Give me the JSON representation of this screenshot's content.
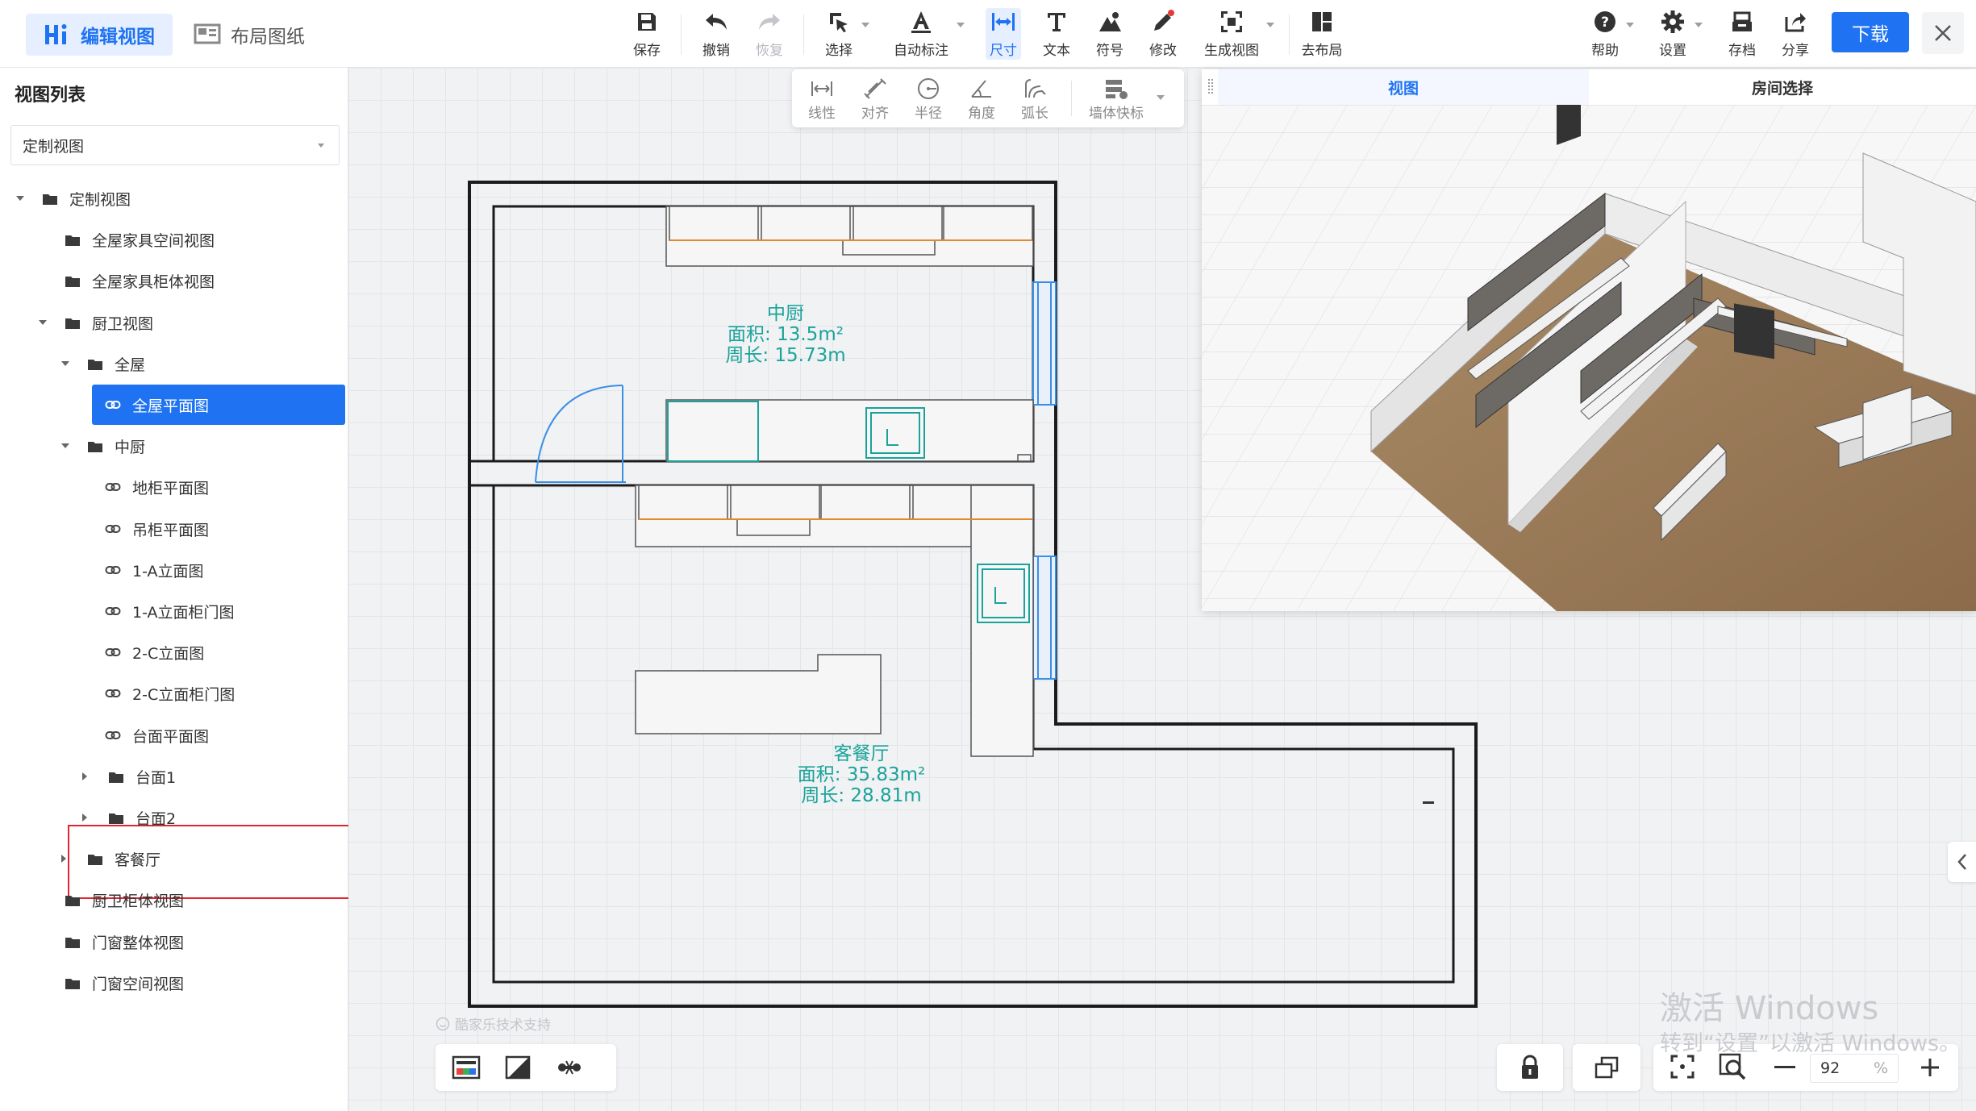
{
  "header": {
    "mode_tabs": [
      {
        "label": "编辑视图",
        "active": true
      },
      {
        "label": "布局图纸",
        "active": false
      }
    ],
    "tools": {
      "save": "保存",
      "undo": "撤销",
      "redo": "恢复",
      "select": "选择",
      "auto_dim": "自动标注",
      "dimension": "尺寸",
      "text": "文本",
      "symbol": "符号",
      "modify": "修改",
      "gen_view": "生成视图",
      "to_layout": "去布局"
    },
    "right_tools": {
      "help": "帮助",
      "settings": "设置",
      "archive": "存档",
      "share": "分享"
    },
    "download": "下载",
    "accent": "#1f73f2"
  },
  "dimension_toolbar": {
    "items": [
      "线性",
      "对齐",
      "半径",
      "角度",
      "弧长",
      "墙体快标"
    ]
  },
  "sidebar": {
    "title": "视图列表",
    "select_value": "定制视图",
    "tree": [
      {
        "label": "定制视图",
        "type": "folder",
        "expanded": true
      },
      {
        "label": "全屋家具空间视图",
        "type": "folder"
      },
      {
        "label": "全屋家具柜体视图",
        "type": "folder"
      },
      {
        "label": "厨卫视图",
        "type": "folder",
        "expanded": true
      },
      {
        "label": "全屋",
        "type": "folder",
        "expanded": true
      },
      {
        "label": "全屋平面图",
        "type": "link",
        "selected": true
      },
      {
        "label": "中厨",
        "type": "folder",
        "expanded": true
      },
      {
        "label": "地柜平面图",
        "type": "link"
      },
      {
        "label": "吊柜平面图",
        "type": "link"
      },
      {
        "label": "1-A立面图",
        "type": "link"
      },
      {
        "label": "1-A立面柜门图",
        "type": "link"
      },
      {
        "label": "2-C立面图",
        "type": "link"
      },
      {
        "label": "2-C立面柜门图",
        "type": "link"
      },
      {
        "label": "台面平面图",
        "type": "link"
      },
      {
        "label": "台面1",
        "type": "folder",
        "collapsed": true
      },
      {
        "label": "台面2",
        "type": "folder",
        "collapsed": true
      },
      {
        "label": "客餐厅",
        "type": "folder",
        "collapsed": true
      },
      {
        "label": "厨卫柜体视图",
        "type": "folder"
      },
      {
        "label": "门窗整体视图",
        "type": "folder"
      },
      {
        "label": "门窗空间视图",
        "type": "folder"
      }
    ]
  },
  "floorplan": {
    "rooms": [
      {
        "name": "中厨",
        "area": "面积: 13.5m²",
        "perimeter": "周长: 15.73m"
      },
      {
        "name": "客餐厅",
        "area": "面积: 35.83m²",
        "perimeter": "周长: 28.81m"
      }
    ],
    "room_label_color": "#1aa39a"
  },
  "view3d": {
    "tabs": [
      "视图",
      "房间选择"
    ],
    "active_tab": "视图"
  },
  "footer": {
    "support_text": "酷家乐技术支持",
    "zoom_value": "92",
    "zoom_unit": "%"
  },
  "os_watermark": {
    "line1": "激活 Windows",
    "line2": "转到“设置”以激活 Windows。"
  }
}
